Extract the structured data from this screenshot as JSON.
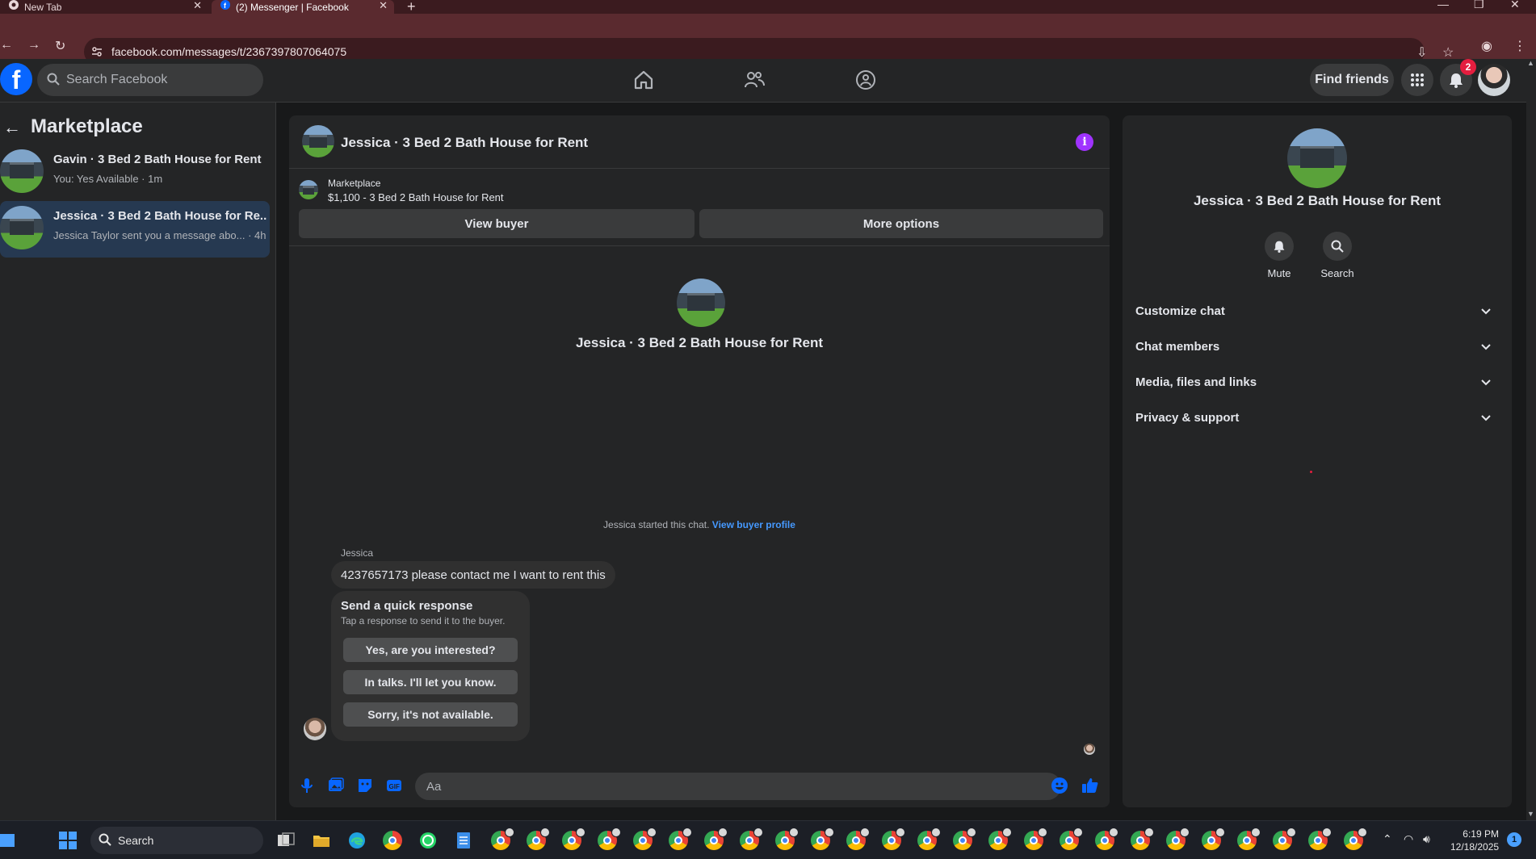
{
  "browser": {
    "tabs": [
      {
        "title": "New Tab"
      },
      {
        "title": "(2) Messenger | Facebook"
      }
    ],
    "url": "facebook.com/messages/t/2367397807064075"
  },
  "fb_header": {
    "search_placeholder": "Search Facebook",
    "find_friends": "Find friends",
    "notification_count": "2"
  },
  "sidebar": {
    "title": "Marketplace",
    "conversations": [
      {
        "name": "Gavin · 3 Bed 2 Bath House for Rent",
        "preview": "You: Yes Available · 1m",
        "active": false
      },
      {
        "name": "Jessica · 3 Bed 2 Bath House for Re...",
        "preview": "Jessica Taylor sent you a message abo... · 4h",
        "active": true
      }
    ]
  },
  "chat": {
    "title": "Jessica · 3 Bed 2 Bath House for Rent",
    "marketplace_label": "Marketplace",
    "listing": "$1,100 - 3 Bed 2 Bath House for Rent",
    "view_buyer": "View buyer",
    "more_options": "More options",
    "intro_title": "Jessica · 3 Bed 2 Bath House for Rent",
    "started_text": "Jessica started this chat.",
    "view_buyer_profile": "View buyer profile",
    "sender": "Jessica",
    "message": "4237657173 please contact me I want to rent this",
    "quick_title": "Send a quick response",
    "quick_subtitle": "Tap a response to send it to the buyer.",
    "quick_responses": [
      "Yes, are you interested?",
      "In talks. I'll let you know.",
      "Sorry, it's not available."
    ],
    "composer_placeholder": "Aa"
  },
  "details": {
    "title": "Jessica · 3 Bed 2 Bath House for Rent",
    "mute": "Mute",
    "search": "Search",
    "sections": [
      "Customize chat",
      "Chat members",
      "Media, files and links",
      "Privacy & support"
    ]
  },
  "taskbar": {
    "search": "Search",
    "time": "6:19 PM",
    "date": "12/18/2025",
    "notification_count": "1"
  },
  "colors": {
    "accent_blue": "#0866ff",
    "link_blue": "#4599ff",
    "info_purple": "#a033ff",
    "badge_red": "#e41e3f",
    "active_conv": "#263951"
  }
}
